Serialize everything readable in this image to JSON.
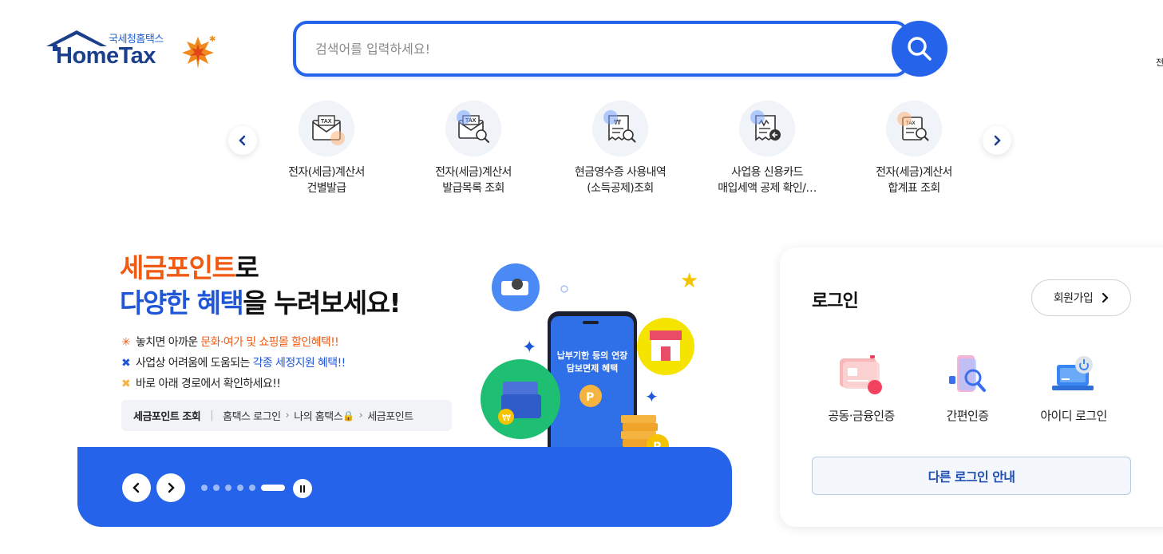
{
  "header": {
    "logo_sub": "국세청홈택스",
    "logo_main": "HomeTax",
    "search_placeholder": "검색어를 입력하세요!",
    "edge_text": "전"
  },
  "quick_menu": {
    "items": [
      {
        "line1": "전자(세금)계산서",
        "line2": "건별발급",
        "icon": "tax-invoice-envelope-icon"
      },
      {
        "line1": "전자(세금)계산서",
        "line2": "발급목록 조회",
        "icon": "tax-invoice-search-icon"
      },
      {
        "line1": "현금영수증 사용내역",
        "line2": "(소득공제)조회",
        "icon": "cash-receipt-search-icon"
      },
      {
        "line1": "사업용 신용카드",
        "line2": "매입세액 공제 확인/…",
        "icon": "credit-card-receipt-icon"
      },
      {
        "line1": "전자(세금)계산서",
        "line2": "합계표 조회",
        "icon": "tax-summary-search-icon"
      }
    ]
  },
  "banner": {
    "title_line1_hl": "세금포인트",
    "title_line1_rest": "로",
    "title_line2_hl": "다양한 혜택",
    "title_line2_rest": "을 누려보세요!",
    "bullet1_pre": "놓치면 아까운 ",
    "bullet1_hl": "문화·여가 및 쇼핑몰 할인혜택!!",
    "bullet2_pre": "사업상 어려움에 도움되는 ",
    "bullet2_hl": "각종 세정지원 혜택!!",
    "bullet3": "바로 아래 경로에서 확인하세요!!",
    "path_label": "세금포인트 조회",
    "path_1": "홈택스 로그인",
    "path_2": "나의 홈택스",
    "path_3": "세금포인트",
    "phone_text": "납부기한 등의 연장\n담보면제 혜택",
    "colors": {
      "orange": "#f05a12",
      "blue": "#1f57d6",
      "bar": "#2563eb"
    }
  },
  "login": {
    "title": "로그인",
    "signup_label": "회원가입",
    "methods": [
      {
        "label": "공동·금융인증",
        "icon": "certificate-card-icon"
      },
      {
        "label": "간편인증",
        "icon": "simple-auth-search-icon"
      },
      {
        "label": "아이디 로그인",
        "icon": "laptop-power-icon"
      }
    ],
    "other_login": "다른 로그인 안내"
  }
}
